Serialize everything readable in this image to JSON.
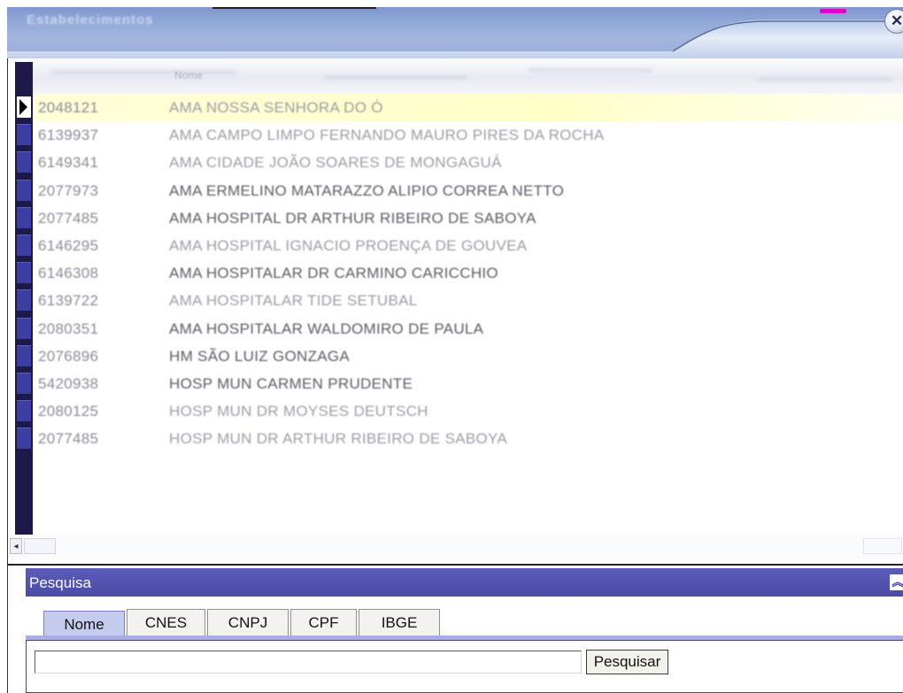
{
  "window": {
    "title": "Estabelecimentos",
    "close_glyph": "✕",
    "close_icon": "close-icon"
  },
  "grid": {
    "header_label": "Nome",
    "rows": [
      {
        "code": "2048121",
        "name": "AMA NOSSA SENHORA DO Ó",
        "selected": true
      },
      {
        "code": "6139937",
        "name": "AMA CAMPO LIMPO FERNANDO MAURO PIRES DA ROCHA",
        "selected": false
      },
      {
        "code": "6149341",
        "name": "AMA CIDADE JOÃO SOARES DE MONGAGUÁ",
        "selected": false
      },
      {
        "code": "2077973",
        "name": "AMA ERMELINO MATARAZZO ALIPIO CORREA NETTO",
        "selected": false
      },
      {
        "code": "2077485",
        "name": "AMA HOSPITAL DR ARTHUR RIBEIRO DE SABOYA",
        "selected": false
      },
      {
        "code": "6146295",
        "name": "AMA HOSPITAL IGNACIO PROENÇA DE GOUVEA",
        "selected": false
      },
      {
        "code": "6146308",
        "name": "AMA HOSPITALAR DR CARMINO CARICCHIO",
        "selected": false
      },
      {
        "code": "6139722",
        "name": "AMA HOSPITALAR TIDE SETUBAL",
        "selected": false
      },
      {
        "code": "2080351",
        "name": "AMA HOSPITALAR WALDOMIRO DE PAULA",
        "selected": false
      },
      {
        "code": "2076896",
        "name": "HM SÃO LUIZ GONZAGA",
        "selected": false
      },
      {
        "code": "5420938",
        "name": "HOSP MUN CARMEN PRUDENTE",
        "selected": false
      },
      {
        "code": "2080125",
        "name": "HOSP MUN DR MOYSES DEUTSCH",
        "selected": false
      },
      {
        "code": "2077485",
        "name": "HOSP MUN DR ARTHUR RIBEIRO DE SABOYA",
        "selected": false
      }
    ],
    "scroll_left_glyph": "◂"
  },
  "search": {
    "header_label": "Pesquisa",
    "collapse_glyph": "︽",
    "tabs": [
      {
        "label": "Nome",
        "active": true
      },
      {
        "label": "CNES",
        "active": false
      },
      {
        "label": "CNPJ",
        "active": false
      },
      {
        "label": "CPF",
        "active": false
      },
      {
        "label": "IBGE",
        "active": false
      }
    ],
    "input_value": "",
    "button_label": "Pesquisar"
  },
  "colors": {
    "accent": "#4a4ca8",
    "indicator": "#3d3ea4",
    "selected_row": "#ffffc8"
  }
}
